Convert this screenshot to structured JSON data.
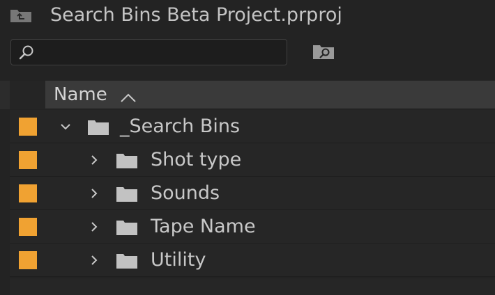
{
  "project": {
    "title": "Search Bins Beta Project.prproj",
    "icon": "project-up-icon"
  },
  "search": {
    "value": "",
    "icon": "magnifier-icon",
    "new_search_bin_icon": "new-search-bin-icon"
  },
  "list": {
    "column_header": "Name",
    "sort_icon": "sort-ascending-icon",
    "label_color": "#f0a232",
    "items": [
      {
        "label": "_Search Bins",
        "expanded": true,
        "depth": 0
      },
      {
        "label": "Shot type",
        "expanded": false,
        "depth": 1
      },
      {
        "label": "Sounds",
        "expanded": false,
        "depth": 1
      },
      {
        "label": "Tape Name",
        "expanded": false,
        "depth": 1
      },
      {
        "label": "Utility",
        "expanded": false,
        "depth": 1
      }
    ]
  }
}
